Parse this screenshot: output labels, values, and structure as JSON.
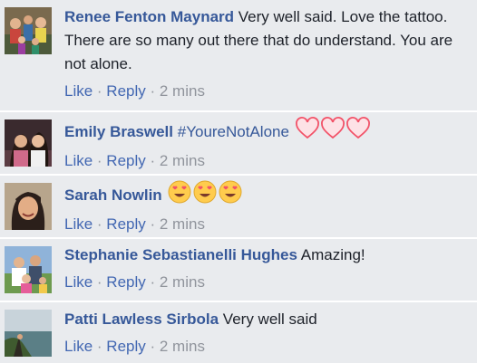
{
  "comments": [
    {
      "author": "Renee Fenton Maynard",
      "text": "Very well said. Love the tattoo. There are so many out there that do understand. You are not alone.",
      "like": "Like",
      "reply": "Reply",
      "time": "2 mins",
      "avatar": "avatar-family-group"
    },
    {
      "author": "Emily Braswell",
      "hashtag": "#YoureNotAlone",
      "like": "Like",
      "reply": "Reply",
      "time": "2 mins",
      "reactions": [
        "heart-outline-icon",
        "heart-outline-icon",
        "heart-outline-icon"
      ],
      "avatar": "avatar-two-women"
    },
    {
      "author": "Sarah Nowlin",
      "like": "Like",
      "reply": "Reply",
      "time": "2 mins",
      "reactions": [
        "heart-eyes-emoji-icon",
        "heart-eyes-emoji-icon",
        "heart-eyes-emoji-icon"
      ],
      "avatar": "avatar-woman-smiling"
    },
    {
      "author": "Stephanie Sebastianelli Hughes",
      "text": "Amazing!",
      "like": "Like",
      "reply": "Reply",
      "time": "2 mins",
      "avatar": "avatar-family-outdoor"
    },
    {
      "author": "Patti Lawless Sirbola",
      "text": "Very well said",
      "like": "Like",
      "reply": "Reply",
      "time": "2 mins",
      "avatar": "avatar-landscape"
    }
  ],
  "separator": " · ",
  "colors": {
    "background": "#e9ebee",
    "author": "#365899",
    "action_link": "#4267b2",
    "meta": "#90949c",
    "heart": "#f25268",
    "emoji_face": "#ffcc4d"
  }
}
